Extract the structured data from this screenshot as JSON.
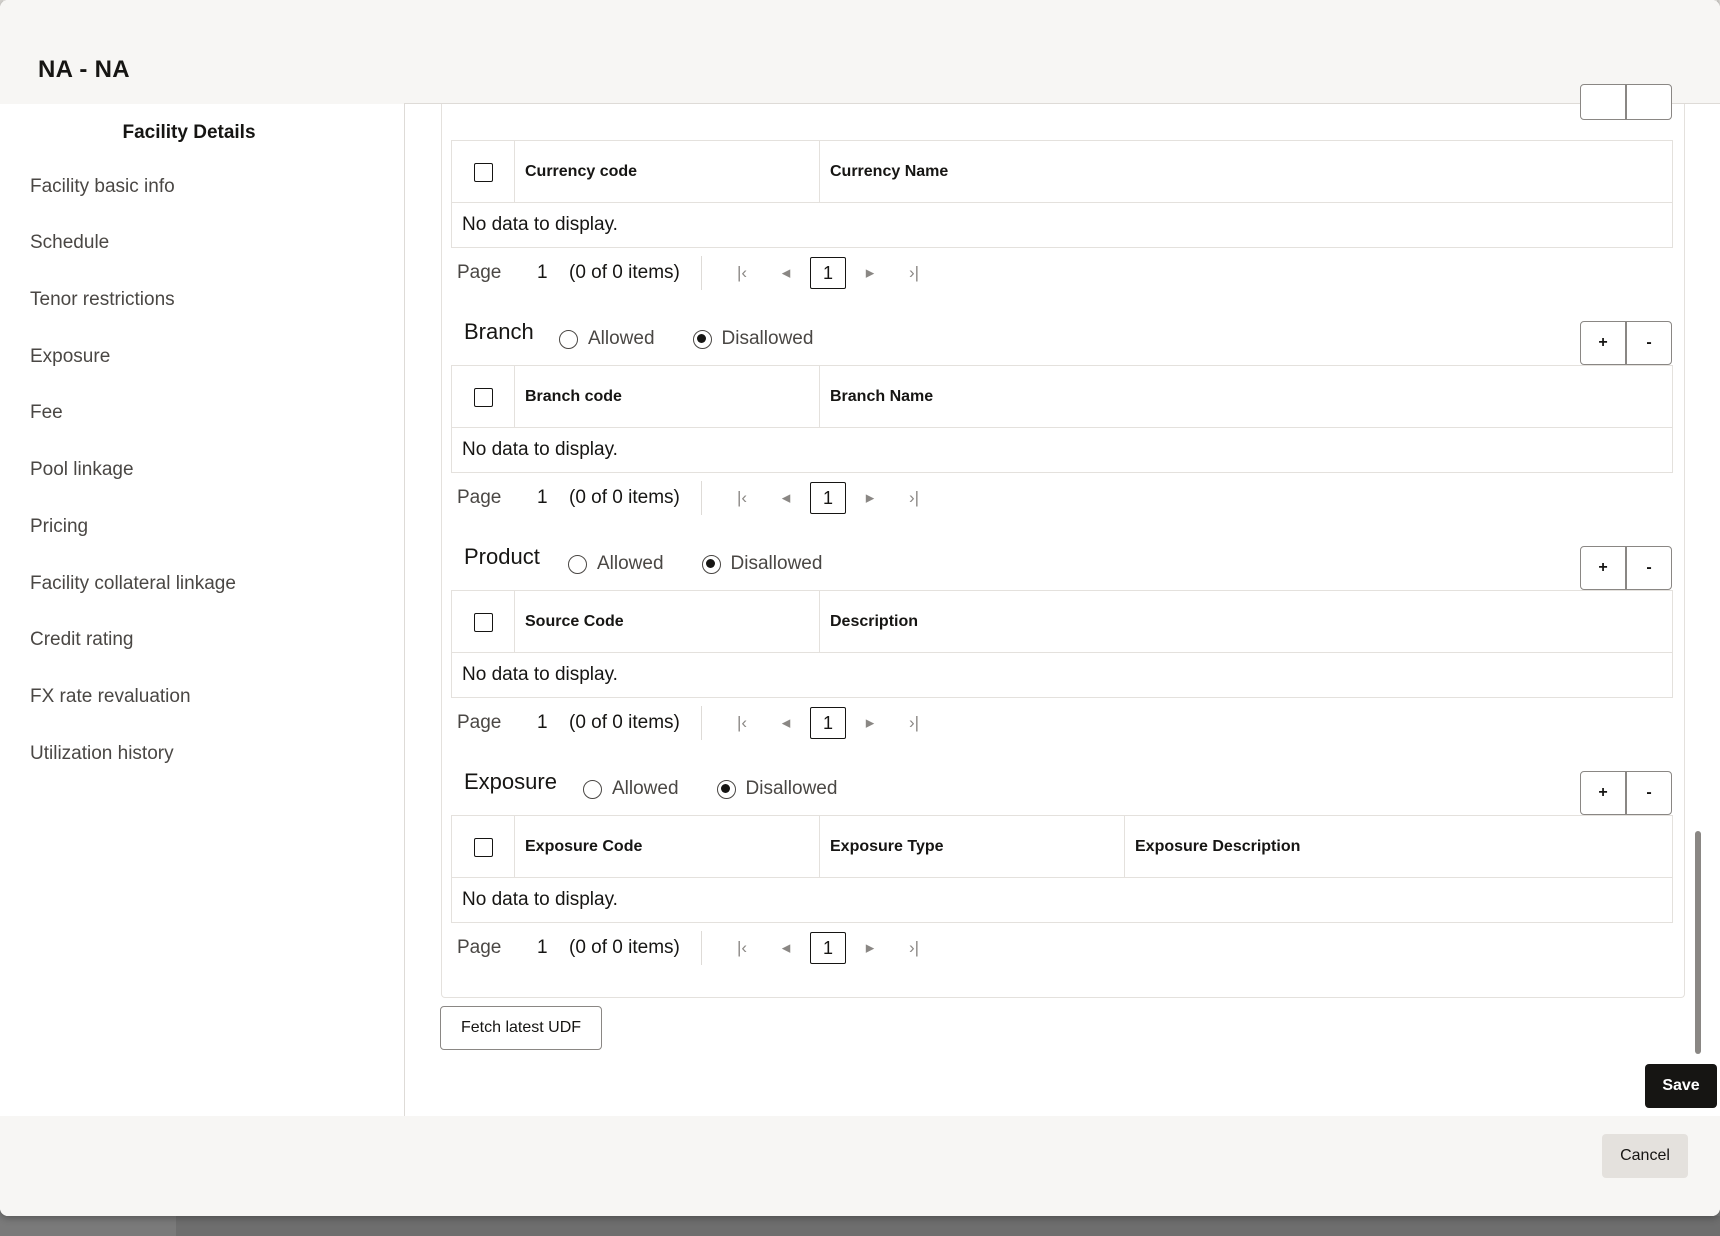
{
  "modal": {
    "title": "NA - NA",
    "cancel_label": "Cancel",
    "save_label": "Save",
    "fetch_label": "Fetch latest UDF"
  },
  "sidebar": {
    "title": "Facility Details",
    "items": [
      {
        "label": "Facility basic info"
      },
      {
        "label": "Schedule"
      },
      {
        "label": "Tenor restrictions"
      },
      {
        "label": "Exposure"
      },
      {
        "label": "Fee"
      },
      {
        "label": "Pool linkage"
      },
      {
        "label": "Pricing"
      },
      {
        "label": "Facility collateral linkage"
      },
      {
        "label": "Credit rating"
      },
      {
        "label": "FX rate revaluation"
      },
      {
        "label": "Utilization history"
      }
    ]
  },
  "sections": {
    "currency": {
      "columns": [
        "Currency code",
        "Currency Name"
      ],
      "empty": "No data to display.",
      "pager": {
        "label": "Page",
        "page": "1",
        "count": "(0 of 0 items)",
        "input": "1"
      }
    },
    "branch": {
      "title": "Branch",
      "allowed": "Allowed",
      "disallowed": "Disallowed",
      "selected": "Disallowed",
      "plus": "+",
      "minus": "-",
      "columns": [
        "Branch code",
        "Branch Name"
      ],
      "empty": "No data to display.",
      "pager": {
        "label": "Page",
        "page": "1",
        "count": "(0 of 0 items)",
        "input": "1"
      }
    },
    "product": {
      "title": "Product",
      "allowed": "Allowed",
      "disallowed": "Disallowed",
      "selected": "Disallowed",
      "plus": "+",
      "minus": "-",
      "columns": [
        "Source Code",
        "Description"
      ],
      "empty": "No data to display.",
      "pager": {
        "label": "Page",
        "page": "1",
        "count": "(0 of 0 items)",
        "input": "1"
      }
    },
    "exposure": {
      "title": "Exposure",
      "allowed": "Allowed",
      "disallowed": "Disallowed",
      "selected": "Disallowed",
      "plus": "+",
      "minus": "-",
      "columns": [
        "Exposure Code",
        "Exposure Type",
        "Exposure Description"
      ],
      "empty": "No data to display.",
      "pager": {
        "label": "Page",
        "page": "1",
        "count": "(0 of 0 items)",
        "input": "1"
      }
    }
  },
  "colors": {
    "primary_button": "#161513",
    "panel_background": "#f7f6f4",
    "border": "#e4e1dd",
    "text_secondary": "#4a4744"
  }
}
